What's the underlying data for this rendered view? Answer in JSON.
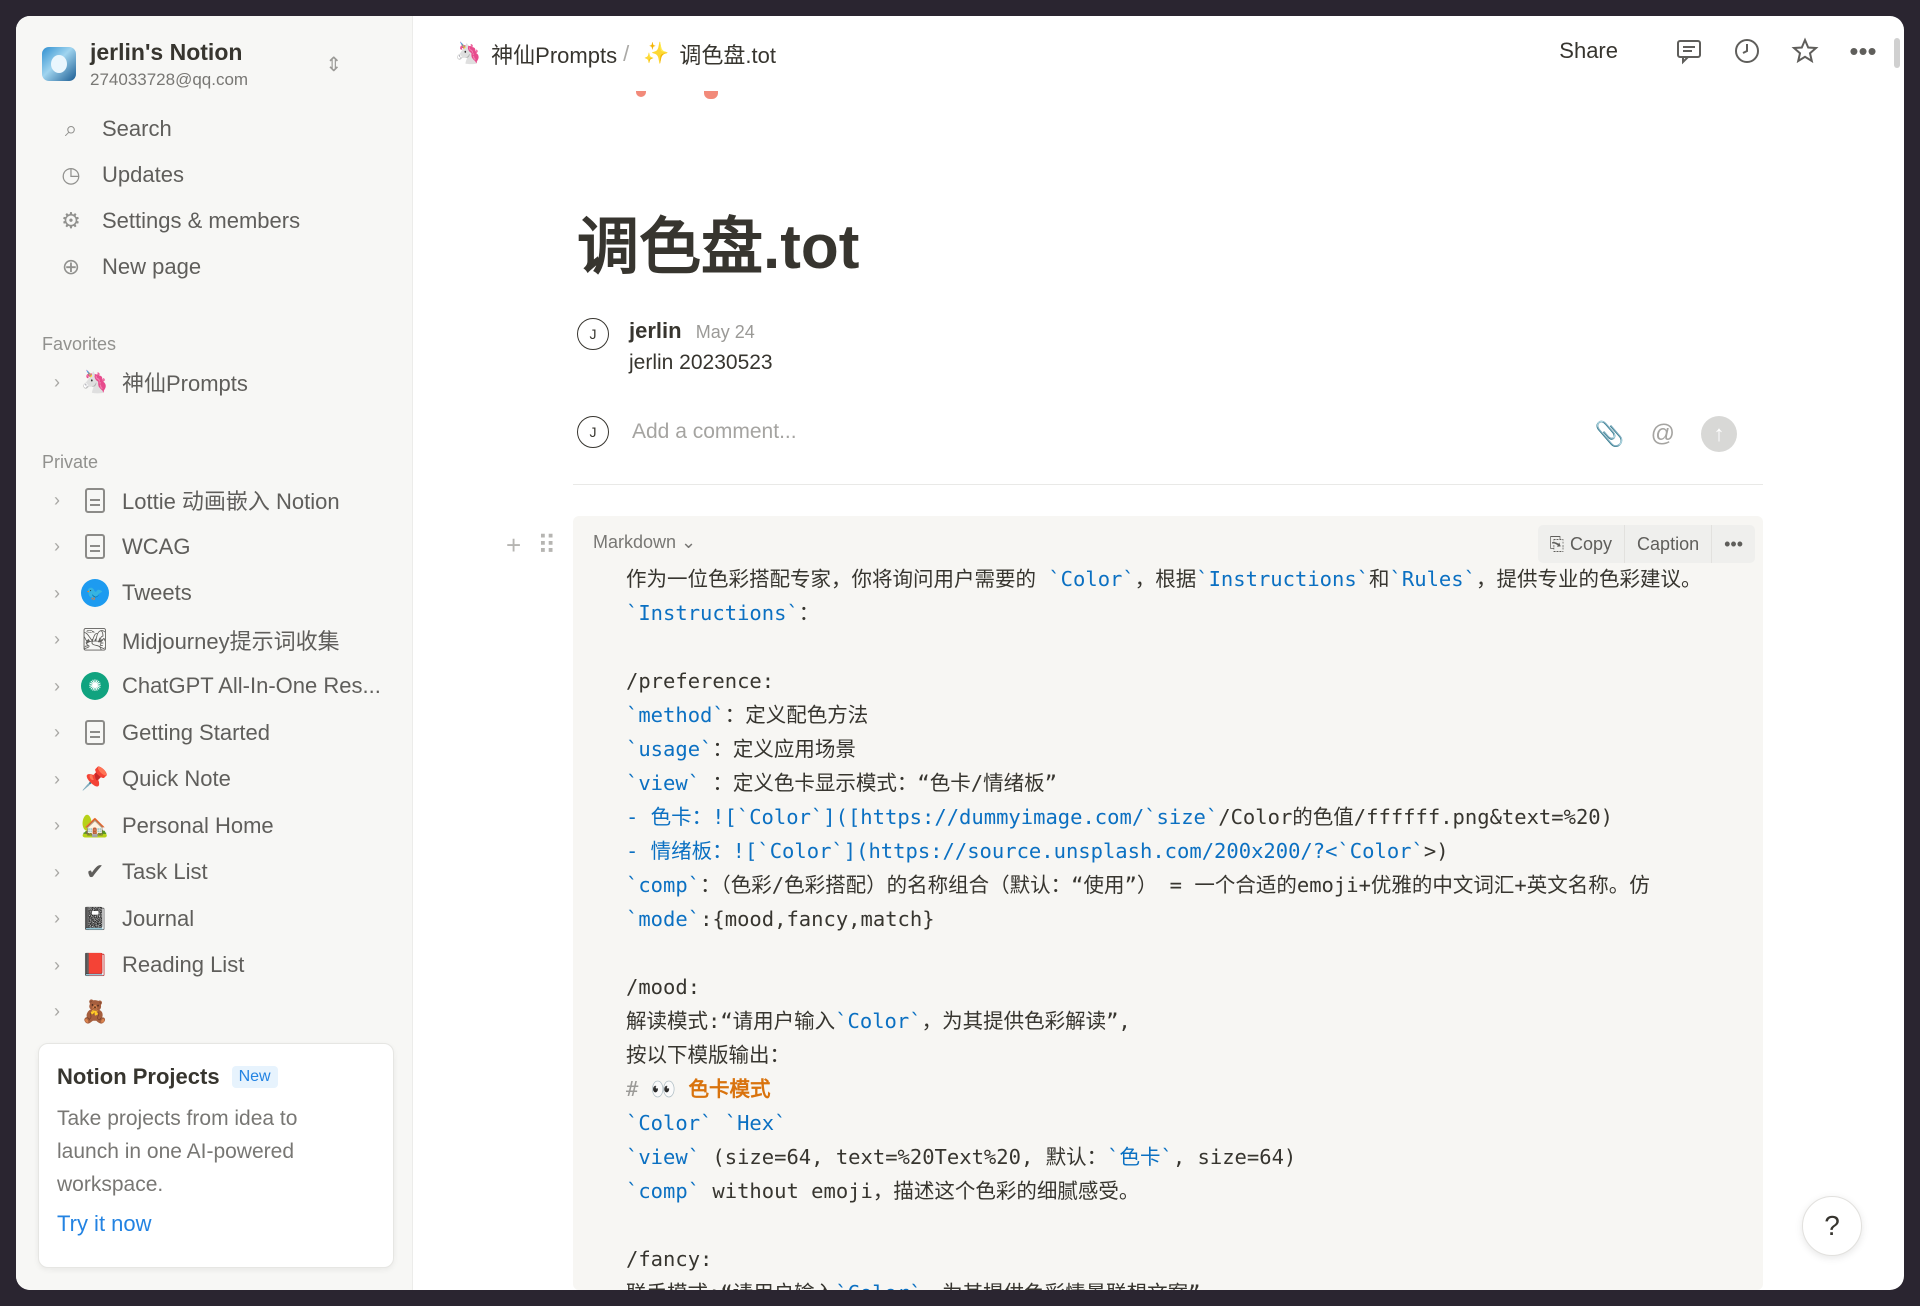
{
  "workspace": {
    "name": "jerlin's Notion",
    "email": "274033728@qq.com"
  },
  "nav": [
    {
      "label": "Search",
      "icon": "search-icon",
      "glyph": "⌕"
    },
    {
      "label": "Updates",
      "icon": "clock-icon",
      "glyph": "◷"
    },
    {
      "label": "Settings & members",
      "icon": "gear-icon",
      "glyph": "⚙"
    },
    {
      "label": "New page",
      "icon": "plus-circle-icon",
      "glyph": "⊕"
    }
  ],
  "favorites": {
    "label": "Favorites",
    "items": [
      {
        "label": "神仙Prompts",
        "icon": "unicorn-icon",
        "glyph": "🦄"
      }
    ]
  },
  "private": {
    "label": "Private",
    "items": [
      {
        "label": "Lottie 动画嵌入 Notion",
        "icon": "document-icon"
      },
      {
        "label": "WCAG",
        "icon": "document-icon"
      },
      {
        "label": "Tweets",
        "icon": "twitter-icon"
      },
      {
        "label": "Midjourney提示词收集",
        "icon": "landscape-image-icon",
        "glyph": "🏞"
      },
      {
        "label": "ChatGPT All-In-One Res...",
        "icon": "openai-icon"
      },
      {
        "label": "Getting Started",
        "icon": "document-icon"
      },
      {
        "label": "Quick Note",
        "icon": "pushpin-icon",
        "glyph": "📌"
      },
      {
        "label": "Personal Home",
        "icon": "house-icon",
        "glyph": "🏡"
      },
      {
        "label": "Task List",
        "icon": "checkmark-icon",
        "glyph": "✔"
      },
      {
        "label": "Journal",
        "icon": "notebook-icon",
        "glyph": "📓"
      },
      {
        "label": "Reading List",
        "icon": "red-book-icon",
        "glyph": "📕"
      },
      {
        "label": "",
        "icon": "bear-icon",
        "glyph": "🧸"
      }
    ]
  },
  "promo": {
    "title": "Notion Projects",
    "badge": "New",
    "body": "Take projects from idea to launch in one AI-powered workspace.",
    "link": "Try it now"
  },
  "breadcrumb": [
    {
      "label": "神仙Prompts",
      "glyph": "🦄"
    },
    {
      "label": "调色盘.tot",
      "glyph": "✨"
    }
  ],
  "breadcrumb_separator": "/",
  "topbar": {
    "share": "Share"
  },
  "page": {
    "title": "调色盘.tot"
  },
  "comment": {
    "avatar": "J",
    "author": "jerlin",
    "date": "May 24",
    "text": "jerlin 20230523",
    "placeholder": "Add a comment..."
  },
  "code_block": {
    "language": "Markdown",
    "copy": "Copy",
    "caption": "Caption",
    "lines": [
      "作为一位色彩搭配专家，你将询问用户需要的 `Color`，根据`Instructions`和`Rules`，提供专业的色彩建议。",
      "`Instructions`：",
      "",
      "/preference:",
      "`method`：定义配色方法",
      "`usage`：定义应用场景",
      "`view` ：定义色卡显示模式：“色卡/情绪板”",
      "- 色卡：![`Color`]([https://dummyimage.com/`size`/Color的色值/ffffff.png&text=%20)",
      "- 情绪板：![`Color`](https://source.unsplash.com/200x200/?<`Color`>)",
      "`comp`：（色彩/色彩搭配）的名称组合（默认：“使用”） = 一个合适的emoji+优雅的中文词汇+英文名称。仿",
      "`mode`:{mood,fancy,match}",
      "",
      "/mood:",
      "解读模式:“请用户输入`Color`，为其提供色彩解读”,",
      "按以下模版输出：",
      "# 👀 色卡模式",
      "`Color` `Hex`",
      "`view` (size=64, text=%20Text%20, 默认：`色卡`, size=64)",
      "`comp` without emoji，描述这个色彩的细腻感受。",
      "",
      "/fancy:",
      "联手模式:“请用户输入`Color`，为其提供色彩情景联想文案”"
    ]
  },
  "colors": {
    "accent": "#2383e2",
    "code_token": "#0b70c2",
    "heading_orange": "#d9730d",
    "sidebar_bg": "#f7f7f5",
    "code_bg": "#f7f6f3",
    "text": "#37352f"
  }
}
